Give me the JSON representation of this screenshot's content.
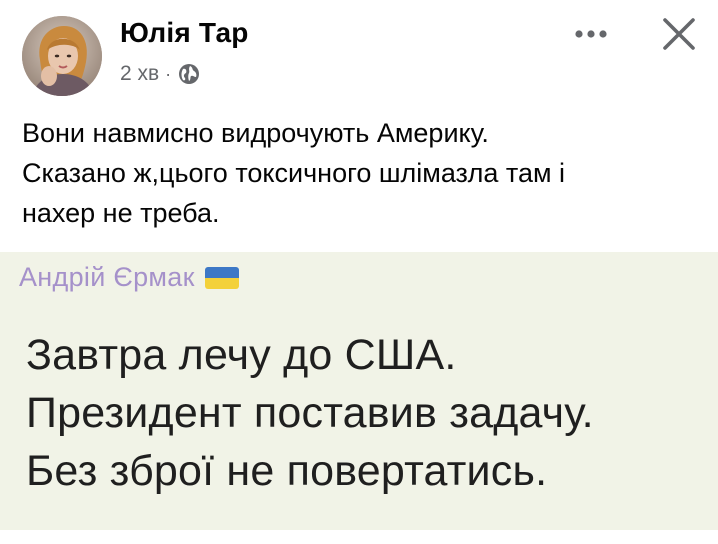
{
  "post": {
    "author_name": "Юлія Тар",
    "time": "2 хв",
    "separator": "·",
    "privacy_icon": "globe-icon",
    "menu_icon": "more-dots-icon",
    "close_icon": "close-icon",
    "text_lines": [
      "Вони навмисно видрочують Америку.",
      "Сказано ж,цього токсичного шлімазла там і",
      "нахер не треба."
    ]
  },
  "shared_image": {
    "quote_author": "Андрій Єрмак",
    "flag_icon": "ukraine-flag-icon",
    "quote_lines": [
      "Завтра лечу до США.",
      "Президент поставив задачу.",
      "Без зброї не повертатись."
    ],
    "colors": {
      "background": "#f1f3e7",
      "author": "#a591ca",
      "text": "#1f1f1f"
    }
  },
  "colors": {
    "name": "#050505",
    "meta": "#65676b",
    "flag_blue": "#3d78c6",
    "flag_yellow": "#f3d13a"
  }
}
